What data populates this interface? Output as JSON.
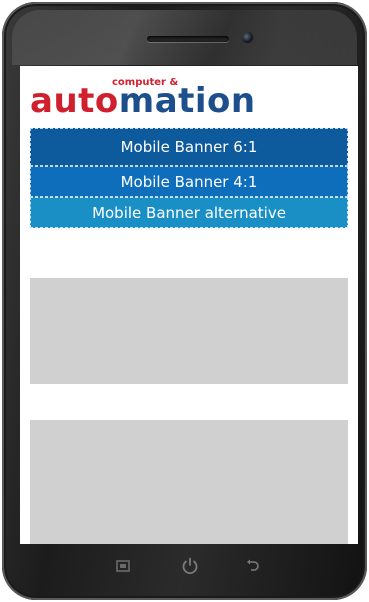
{
  "logo": {
    "small_text": "computer &",
    "part_red": "auto",
    "part_blue": "mation"
  },
  "banners": [
    {
      "label": "Mobile Banner 6:1",
      "color": "#0d5a9c"
    },
    {
      "label": "Mobile Banner 4:1",
      "color": "#0f6ebc"
    },
    {
      "label": "Mobile Banner alternative",
      "color": "#1a8fc6"
    }
  ],
  "ad_placeholder_color": "#d0d0d0",
  "nav_buttons": [
    {
      "icon": "recent-apps-icon"
    },
    {
      "icon": "power-icon"
    },
    {
      "icon": "back-icon"
    }
  ],
  "brand_colors": {
    "red": "#d0202e",
    "blue": "#1d4f8c"
  }
}
